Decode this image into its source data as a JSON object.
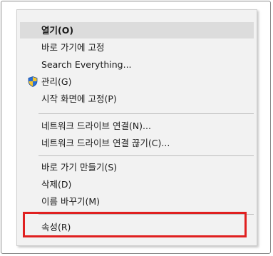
{
  "context_menu": {
    "items": [
      {
        "label": "열기(O)"
      },
      {
        "label": "바로 가기에 고정"
      },
      {
        "label": "Search Everything..."
      },
      {
        "label": "관리(G)",
        "icon": "uac-shield-icon"
      },
      {
        "label": "시작 화면에 고정(P)"
      },
      {
        "label": "네트워크 드라이브 연결(N)..."
      },
      {
        "label": "네트워크 드라이브 연결 끊기(C)..."
      },
      {
        "label": "바로 가기 만들기(S)"
      },
      {
        "label": "삭제(D)"
      },
      {
        "label": "이름 바꾸기(M)"
      },
      {
        "label": "속성(R)"
      }
    ]
  },
  "colors": {
    "menu_background": "#f2f2f2",
    "highlight": "#dcdcdc",
    "callout_border": "#e02020",
    "shield_blue": "#2a6fd6",
    "shield_yellow": "#f4c531"
  }
}
